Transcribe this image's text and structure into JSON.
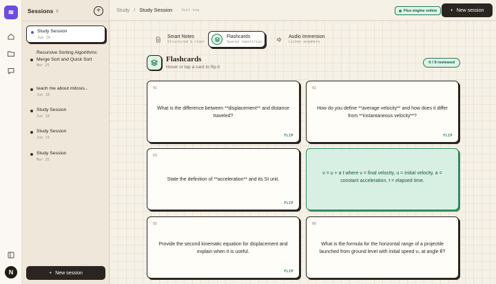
{
  "rail": {
    "logo": "≋",
    "avatar": "N"
  },
  "sessions": {
    "title": "Sessions",
    "count": "6",
    "items": [
      {
        "name": "Study Session",
        "date": "Jun 19"
      },
      {
        "name": "Recursive Sorting Algorithms: Merge Sort and Quick Sort",
        "date": "Mar 25"
      },
      {
        "name": "teach me about mitosis...",
        "date": "Jun 18"
      },
      {
        "name": "Study Session",
        "date": "Jun 18"
      },
      {
        "name": "Study Session",
        "date": "Jun 19"
      },
      {
        "name": "Study Session",
        "date": "Mar 25"
      }
    ],
    "new_label": "New session"
  },
  "header": {
    "crumb_root": "Study",
    "crumb_sep": "/",
    "crumb_current": "Study Session",
    "crumb_time": "· Just now",
    "engine_status": "Flux engine online",
    "new_label": "New session"
  },
  "tabs": [
    {
      "label": "Smart Notes",
      "sub": "Structured & clear"
    },
    {
      "label": "Flashcards",
      "sub": "Spaced repetition"
    },
    {
      "label": "Audio Immersion",
      "sub": "Listen anywhere"
    }
  ],
  "flashcards": {
    "title": "Flashcards",
    "subtitle": "Hover or tap a card to flip it",
    "reviewed": "0 / 9 reviewed",
    "flip_label": "FLIP",
    "cards": [
      {
        "num": "01",
        "text": "What is the difference between **displacement** and distance traveled?"
      },
      {
        "num": "02",
        "text": "How do you define **average velocity** and how does it differ from **instantaneous velocity**?"
      },
      {
        "num": "03",
        "text": "State the definition of **acceleration** and its SI unit."
      },
      {
        "num": "04",
        "text": "v = u + a t where v = final velocity, u = initial velocity, a = constant acceleration, t = elapsed time."
      },
      {
        "num": "05",
        "text": "Provide the second kinematic equation for displacement and explain when it is useful."
      },
      {
        "num": "06",
        "text": "What is the formula for the horizontal range of a projectile launched from ground level with initial speed v₀ at angle θ?"
      }
    ]
  },
  "colors": {
    "accent": "#6c4be0",
    "green": "#1f7a52",
    "dark": "#2a2520"
  }
}
